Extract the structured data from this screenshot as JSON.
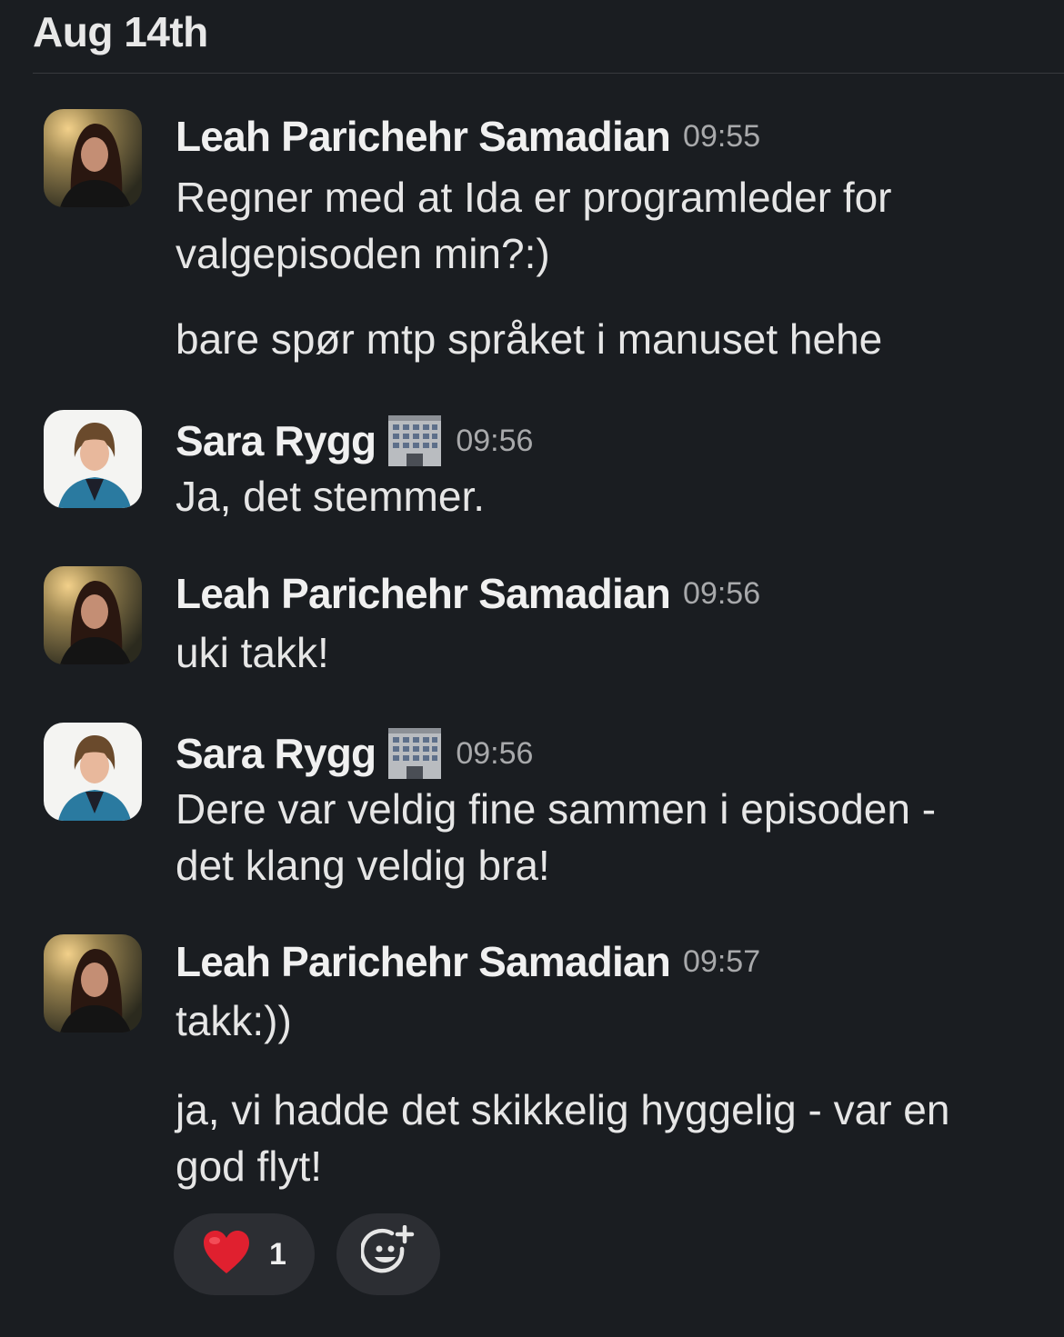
{
  "date_header": "Aug 14th",
  "messages": [
    {
      "author": "Leah Parichehr Samadian",
      "time": "09:55",
      "badge_icon": null,
      "lines": [
        "Regner med at Ida er programleder for\nvalgepisoden min?:)",
        "bare spør mtp språket i manuset hehe"
      ]
    },
    {
      "author": "Sara Rygg",
      "time": "09:56",
      "badge_icon": "office-building-icon",
      "lines": [
        "Ja, det stemmer."
      ]
    },
    {
      "author": "Leah Parichehr Samadian",
      "time": "09:56",
      "badge_icon": null,
      "lines": [
        "uki takk!"
      ]
    },
    {
      "author": "Sara Rygg",
      "time": "09:56",
      "badge_icon": "office-building-icon",
      "lines": [
        "Dere var veldig fine sammen i episoden -\ndet klang veldig bra!"
      ]
    },
    {
      "author": "Leah Parichehr Samadian",
      "time": "09:57",
      "badge_icon": null,
      "lines": [
        "takk:))",
        "ja, vi hadde det skikkelig hyggelig - var en\ngod flyt!"
      ]
    }
  ],
  "reactions": [
    {
      "icon": "red-heart-icon",
      "count": "1"
    },
    {
      "icon": "add-reaction-icon",
      "count": null
    }
  ],
  "colors": {
    "background": "#1a1d21",
    "text": "#e6e6e6",
    "timestamp": "#a8a9ab",
    "pill": "#2c2e33",
    "heart": "#e0202f"
  }
}
